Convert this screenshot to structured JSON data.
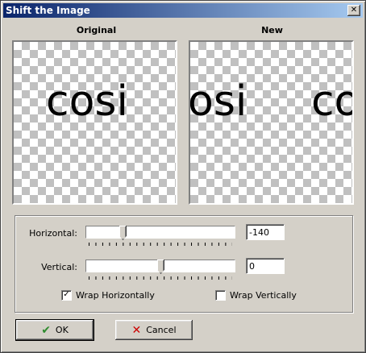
{
  "window": {
    "title": "Shift the Image",
    "close_label": "✕"
  },
  "panels": {
    "original_label": "Original",
    "new_label": "New",
    "original_text": "cosi",
    "new_text_left": "osi",
    "new_text_right": "co"
  },
  "controls": {
    "horizontal": {
      "label": "Horizontal:",
      "value": "-140",
      "slider_fraction": 0.24
    },
    "vertical": {
      "label": "Vertical:",
      "value": "0",
      "slider_fraction": 0.5
    },
    "wrap_horizontally": {
      "label": "Wrap Horizontally",
      "checked": true,
      "mark": "✓"
    },
    "wrap_vertically": {
      "label": "Wrap Vertically",
      "checked": false,
      "mark": ""
    }
  },
  "buttons": {
    "ok": {
      "label": "OK",
      "icon": "checkmark-icon",
      "glyph": "✔",
      "color": "#2e8b2e"
    },
    "cancel": {
      "label": "Cancel",
      "icon": "x-icon",
      "glyph": "✕",
      "color": "#cc0000"
    }
  }
}
